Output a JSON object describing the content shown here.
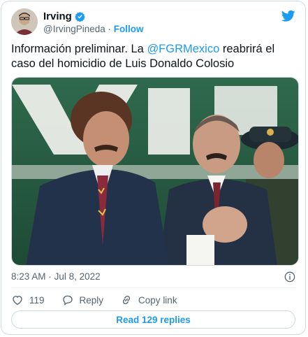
{
  "author": {
    "name": "Irving",
    "handle": "@IrvingPineda",
    "separator": "·",
    "follow_label": "Follow",
    "verified": true
  },
  "tweet": {
    "text_before": "Información preliminar. La ",
    "mention": "@FGRMexico",
    "text_after": " reabrirá el caso del homicidio de Luis Donaldo Colosio"
  },
  "photo": {
    "description_icon": "photo-image"
  },
  "meta": {
    "time": "8:23 AM",
    "separator": "·",
    "date": "Jul 8, 2022"
  },
  "actions": {
    "like_count": "119",
    "reply_label": "Reply",
    "copy_label": "Copy link"
  },
  "read_replies_label": "Read 129 replies",
  "colors": {
    "accent": "#1d9bf0",
    "text": "#0f1419",
    "muted": "#536471",
    "border": "#cfd9de"
  }
}
